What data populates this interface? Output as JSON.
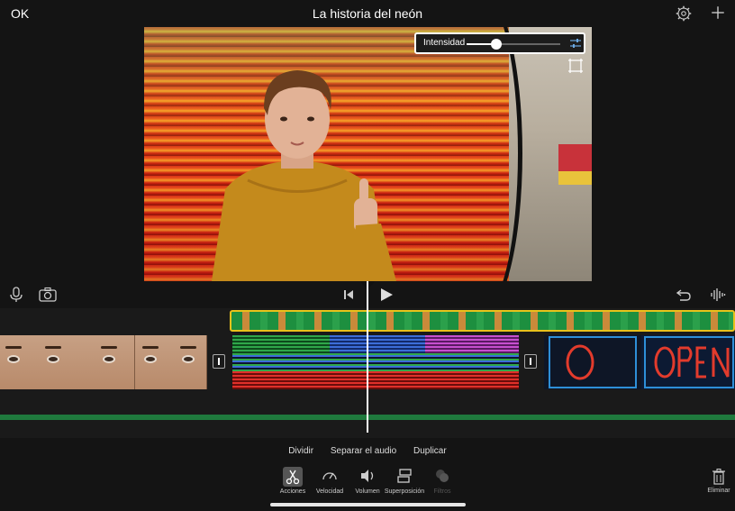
{
  "topbar": {
    "ok_label": "OK",
    "title": "La historia del neón",
    "settings_icon": "gear-icon",
    "add_icon": "plus-icon"
  },
  "viewer": {
    "intensity_label": "Intensidad",
    "intensity_value": 0.32
  },
  "controls": {
    "mic_icon": "microphone-icon",
    "camera_icon": "camera-icon",
    "skip_back_icon": "skip-to-start-icon",
    "play_icon": "play-icon",
    "undo_icon": "undo-icon",
    "audio_icon": "waveform-icon"
  },
  "edit_actions": [
    "Dividir",
    "Separar el audio",
    "Duplicar"
  ],
  "toolbar": {
    "acciones": "Acciones",
    "velocidad": "Velocidad",
    "volumen": "Volumen",
    "superposicion": "Superposición",
    "filtros": "Filtros",
    "eliminar": "Eliminar"
  },
  "colors": {
    "overlay_clip_border": "#e8c21b",
    "audio_track": "#1f7a3d"
  }
}
